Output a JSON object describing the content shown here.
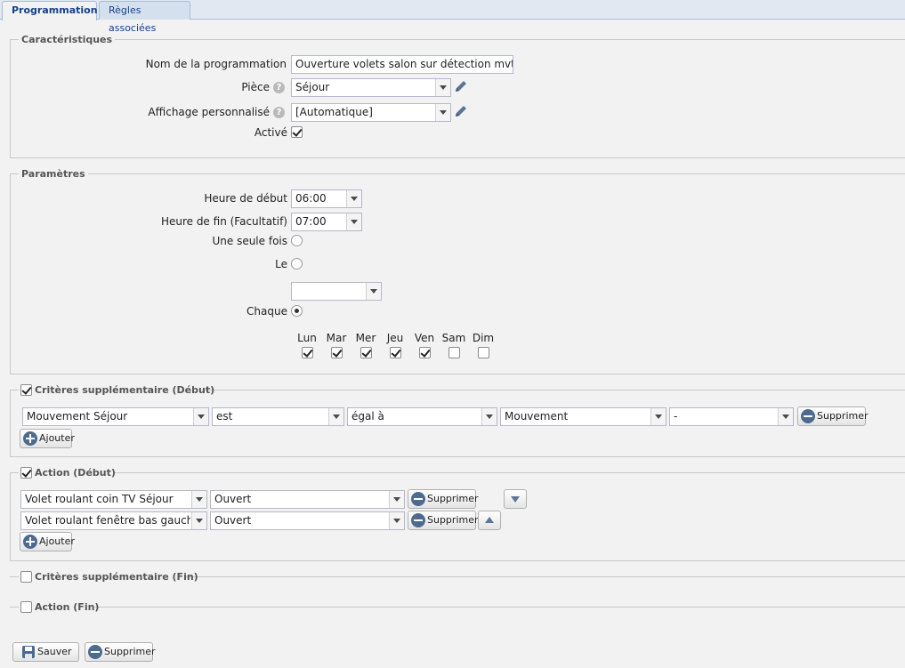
{
  "tabs": [
    {
      "label": "Programmation"
    },
    {
      "label": "Règles associées"
    }
  ],
  "caracteristiques": {
    "legend": "Caractéristiques",
    "nom_label": "Nom de la programmation",
    "nom_value": "Ouverture volets salon sur détection mvt",
    "piece_label": "Pièce",
    "piece_value": "Séjour",
    "affichage_label": "Affichage personnalisé",
    "affichage_value": "[Automatique]",
    "active_label": "Activé",
    "active_checked": true
  },
  "parametres": {
    "legend": "Paramètres",
    "heure_debut_label": "Heure de début",
    "heure_debut_value": "06:00",
    "heure_fin_label": "Heure de fin (Facultatif)",
    "heure_fin_value": "07:00",
    "une_seule_fois_label": "Une seule fois",
    "le_label": "Le",
    "le_value": "",
    "chaque_label": "Chaque",
    "days": [
      {
        "label": "Lun",
        "checked": true
      },
      {
        "label": "Mar",
        "checked": true
      },
      {
        "label": "Mer",
        "checked": true
      },
      {
        "label": "Jeu",
        "checked": true
      },
      {
        "label": "Ven",
        "checked": true
      },
      {
        "label": "Sam",
        "checked": false
      },
      {
        "label": "Dim",
        "checked": false
      }
    ]
  },
  "criteres_debut": {
    "legend": "Critères supplémentaire (Début)",
    "row": {
      "device": "Mouvement Séjour",
      "verb": "est",
      "op": "égal à",
      "value": "Mouvement",
      "extra": "-"
    },
    "delete_label": "Supprimer",
    "add_label": "Ajouter"
  },
  "action_debut": {
    "legend": "Action (Début)",
    "rows": [
      {
        "device": "Volet roulant coin TV Séjour",
        "state": "Ouvert"
      },
      {
        "device": "Volet roulant fenêtre bas gauche S",
        "state": "Ouvert"
      }
    ],
    "delete_label": "Supprimer",
    "add_label": "Ajouter"
  },
  "criteres_fin": {
    "legend": "Critères supplémentaire (Fin)"
  },
  "action_fin": {
    "legend": "Action (Fin)"
  },
  "footer": {
    "save_label": "Sauver",
    "delete_label": "Supprimer"
  }
}
